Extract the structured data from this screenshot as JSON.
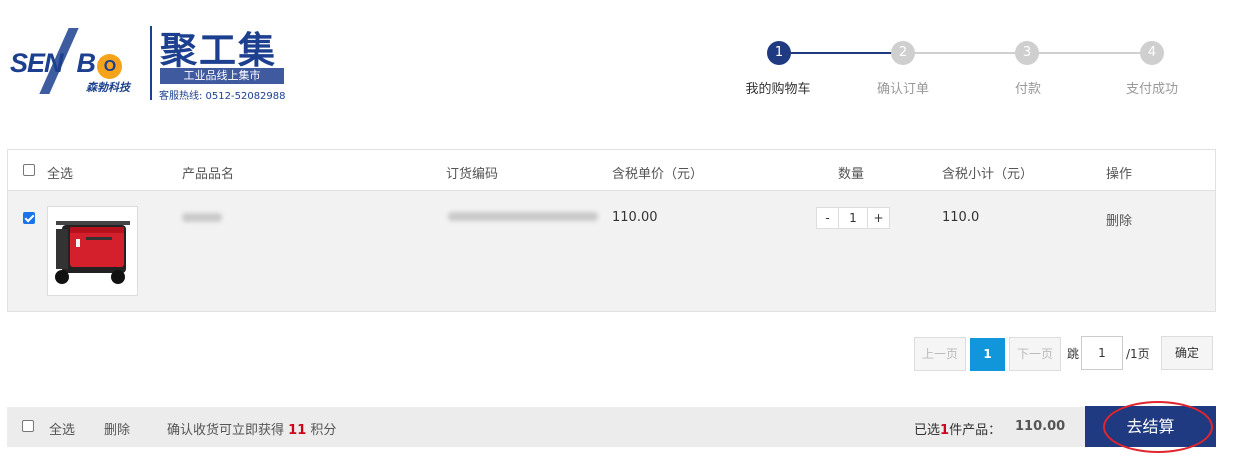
{
  "brand": {
    "logo_text": "SENBO",
    "logo_sub": "森勃科技",
    "name": "聚工集",
    "tagline": "工业品线上集市",
    "hotline": "客服热线: 0512-52082988"
  },
  "steps": [
    {
      "num": "1",
      "label": "我的购物车",
      "active": true
    },
    {
      "num": "2",
      "label": "确认订单",
      "active": false
    },
    {
      "num": "3",
      "label": "付款",
      "active": false
    },
    {
      "num": "4",
      "label": "支付成功",
      "active": false
    }
  ],
  "table": {
    "select_all": "全选",
    "columns": {
      "name": "产品品名",
      "code": "订货编码",
      "price": "含税单价（元）",
      "qty": "数量",
      "subtotal": "含税小计（元）",
      "action": "操作"
    },
    "rows": [
      {
        "checked": true,
        "image_icon": "generator-product-image",
        "price": "110.00",
        "qty_minus": "-",
        "qty": "1",
        "qty_plus": "+",
        "subtotal": "110.0",
        "delete": "删除"
      }
    ]
  },
  "pagination": {
    "prev": "上一页",
    "current": "1",
    "next": "下一页",
    "jump_prefix": "跳",
    "jump_value": "1",
    "jump_suffix": "/1页",
    "confirm": "确定"
  },
  "footer": {
    "select_all": "全选",
    "delete": "删除",
    "points_prefix": "确认收货可立即获得",
    "points_value": "11",
    "points_suffix": "积分",
    "selected_prefix": "已选",
    "selected_count": "1",
    "selected_suffix": "件产品：",
    "total": "110.00",
    "checkout": "去结算"
  },
  "colors": {
    "primary": "#1f3a80",
    "accent": "#1296db",
    "price_red": "#d0021b",
    "highlight_ring": "#e0252d"
  }
}
